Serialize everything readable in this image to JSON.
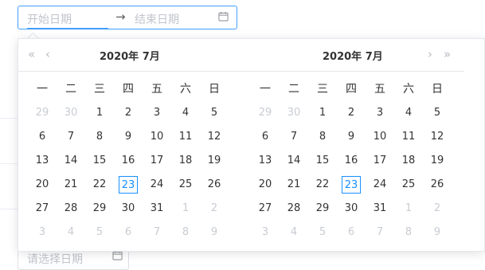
{
  "range_picker": {
    "start_placeholder": "开始日期",
    "separator": "→",
    "end_placeholder": "结束日期"
  },
  "bottom_picker": {
    "placeholder": "请选择日期"
  },
  "weekdays": [
    "一",
    "二",
    "三",
    "四",
    "五",
    "六",
    "日"
  ],
  "left_calendar": {
    "title": "2020年  7月",
    "nav_prev_year": "«",
    "nav_prev_month": "‹"
  },
  "right_calendar": {
    "title": "2020年  7月",
    "nav_next_month": "›",
    "nav_next_year": "»"
  },
  "calendar_days": [
    {
      "label": "29",
      "other": true
    },
    {
      "label": "30",
      "other": true
    },
    {
      "label": "1",
      "other": false
    },
    {
      "label": "2",
      "other": false
    },
    {
      "label": "3",
      "other": false
    },
    {
      "label": "4",
      "other": false
    },
    {
      "label": "5",
      "other": false
    },
    {
      "label": "6",
      "other": false
    },
    {
      "label": "7",
      "other": false
    },
    {
      "label": "8",
      "other": false
    },
    {
      "label": "9",
      "other": false
    },
    {
      "label": "10",
      "other": false
    },
    {
      "label": "11",
      "other": false
    },
    {
      "label": "12",
      "other": false
    },
    {
      "label": "13",
      "other": false
    },
    {
      "label": "14",
      "other": false
    },
    {
      "label": "15",
      "other": false
    },
    {
      "label": "16",
      "other": false
    },
    {
      "label": "17",
      "other": false
    },
    {
      "label": "18",
      "other": false
    },
    {
      "label": "19",
      "other": false
    },
    {
      "label": "20",
      "other": false
    },
    {
      "label": "21",
      "other": false
    },
    {
      "label": "22",
      "other": false
    },
    {
      "label": "23",
      "other": false,
      "today": true
    },
    {
      "label": "24",
      "other": false
    },
    {
      "label": "25",
      "other": false
    },
    {
      "label": "26",
      "other": false
    },
    {
      "label": "27",
      "other": false
    },
    {
      "label": "28",
      "other": false
    },
    {
      "label": "29",
      "other": false
    },
    {
      "label": "30",
      "other": false
    },
    {
      "label": "31",
      "other": false
    },
    {
      "label": "1",
      "other": true
    },
    {
      "label": "2",
      "other": true
    },
    {
      "label": "3",
      "other": true
    },
    {
      "label": "4",
      "other": true
    },
    {
      "label": "5",
      "other": true
    },
    {
      "label": "6",
      "other": true
    },
    {
      "label": "7",
      "other": true
    },
    {
      "label": "8",
      "other": true
    },
    {
      "label": "9",
      "other": true
    }
  ],
  "colors": {
    "accent": "#409eff",
    "today_border": "#1890ff",
    "muted_text": "#c8ccd2",
    "placeholder": "#c0c4cc"
  },
  "icons": {
    "calendar": "calendar-icon",
    "range_arrow": "arrow-right-icon",
    "double_left": "double-chevron-left-icon",
    "left": "chevron-left-icon",
    "right": "chevron-right-icon",
    "double_right": "double-chevron-right-icon"
  }
}
